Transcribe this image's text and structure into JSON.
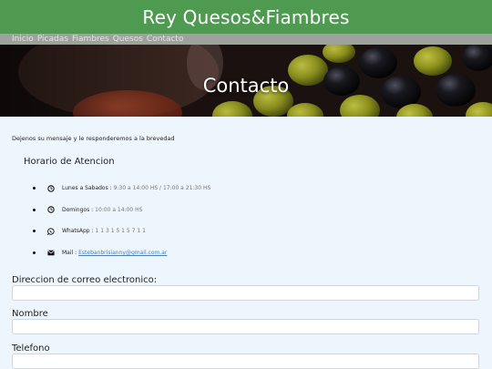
{
  "header": {
    "title": "Rey Quesos&Fiambres"
  },
  "nav": {
    "items": [
      "Inicio",
      "Picadas",
      "Fiambres",
      "Quesos",
      "Contacto"
    ]
  },
  "hero": {
    "title": "Contacto"
  },
  "intro": "Dejenos su mensaje y le responderemos a la brevedad",
  "schedule": {
    "title": "Horario de Atencion",
    "items": [
      {
        "icon": "clock-icon",
        "label": "Lunes a Sabados :",
        "value": " 9:30 a 14:00 HS / 17:00 a 21:30 HS"
      },
      {
        "icon": "clock-icon",
        "label": "Domingos :",
        "value": " 10:00 a 14:00 HS"
      },
      {
        "icon": "whatsapp-icon",
        "label": "WhatsApp :",
        "value": " 1 1 3 1 5 1 5 7 1 1"
      },
      {
        "icon": "envelope-icon",
        "label": "Mail :",
        "value": " Estebanbrisianny@gmail.com.ar"
      }
    ]
  },
  "form": {
    "email_label": "Direccion de correo electronico:",
    "email_value": "",
    "name_label": "Nombre",
    "name_value": "",
    "phone_label": "Telefono",
    "phone_value": ""
  },
  "colors": {
    "header_bg": "#4e9a51",
    "nav_bg": "#9fa29c",
    "page_bg": "#eef6fd",
    "link": "#4a7fb5"
  }
}
